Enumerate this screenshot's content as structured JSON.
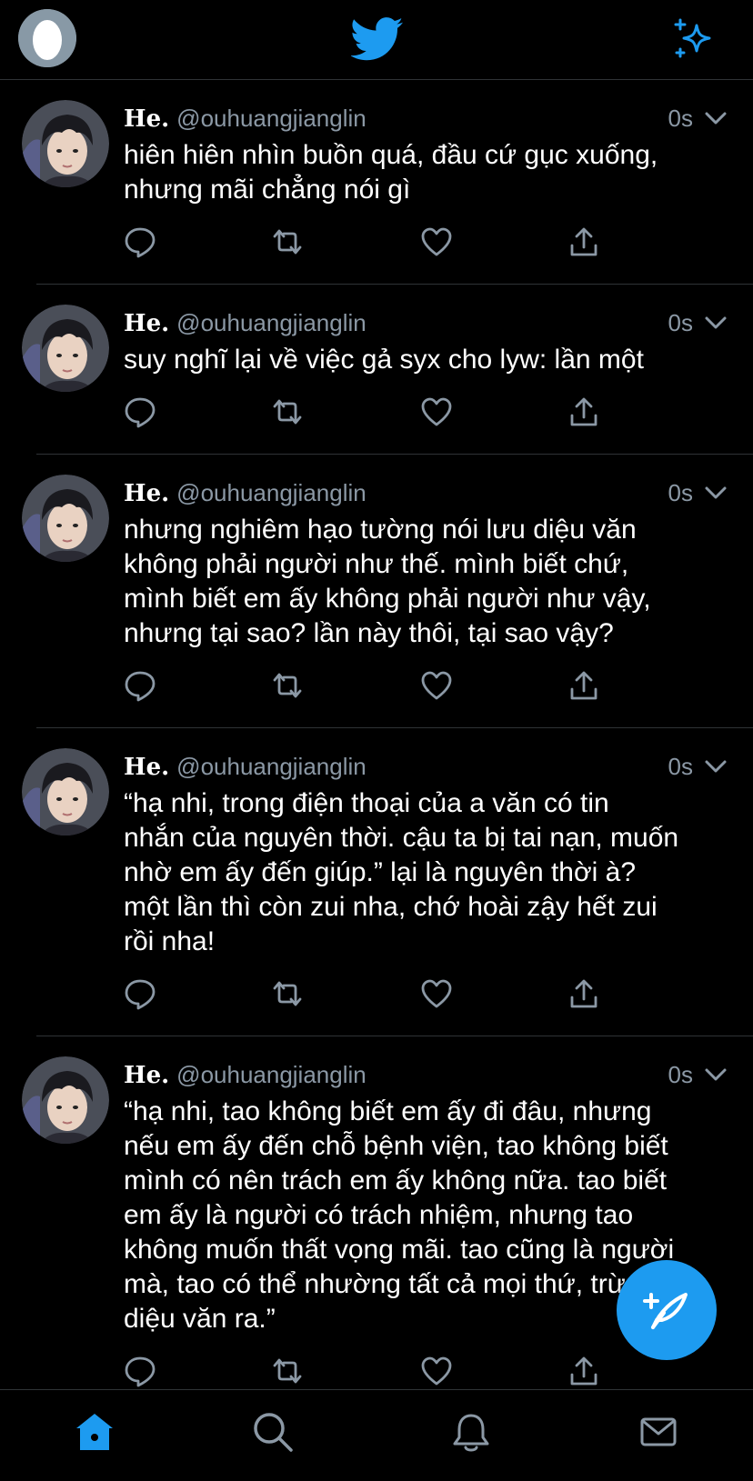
{
  "colors": {
    "accent": "#1d9bf0",
    "muted": "#8b98a5",
    "divider": "#2f3336"
  },
  "header": {
    "profile_icon": "default-egg-avatar",
    "logo": "twitter-bird-icon",
    "action_icon": "sparkle-icon"
  },
  "tweets": [
    {
      "name": "He.",
      "handle": "@ouhuangjianglin",
      "time": "0s",
      "text": "hiên hiên nhìn buồn quá, đầu cứ gục xuống,\nnhưng mãi chẳng nói gì"
    },
    {
      "name": "He.",
      "handle": "@ouhuangjianglin",
      "time": "0s",
      "text": "suy nghĩ lại về việc gả syx cho lyw: lần một"
    },
    {
      "name": "He.",
      "handle": "@ouhuangjianglin",
      "time": "0s",
      "text": "nhưng nghiêm hạo tường nói lưu diệu văn\nkhông phải người như thế. mình biết chứ,\nmình biết em ấy không phải người như vậy,\nnhưng tại sao? lần này thôi, tại sao vậy?"
    },
    {
      "name": "He.",
      "handle": "@ouhuangjianglin",
      "time": "0s",
      "text": "“hạ nhi, trong điện thoại của a văn có tin\nnhắn của nguyên thời. cậu ta bị tai nạn, muốn\nnhờ em ấy đến giúp.” lại là nguyên thời à?\nmột lần thì còn zui nha, chớ hoài zậy hết zui\nrồi nha!"
    },
    {
      "name": "He.",
      "handle": "@ouhuangjianglin",
      "time": "0s",
      "text": "“hạ nhi, tao không biết em ấy đi đâu, nhưng\nnếu em ấy đến chỗ bệnh viện, tao không biết\nmình có nên trách em ấy không nữa. tao biết\nem ấy là người có trách nhiệm, nhưng tao\nkhông muốn thất vọng mãi. tao cũng là người\nmà, tao có thể nhường tất cả mọi thứ, trừ lưu\ndiệu văn ra.”"
    }
  ],
  "tabbar": {
    "items": [
      "home-icon",
      "search-icon",
      "notifications-icon",
      "messages-icon"
    ],
    "active": "home-icon"
  },
  "fab": {
    "icon": "compose-tweet-icon"
  }
}
